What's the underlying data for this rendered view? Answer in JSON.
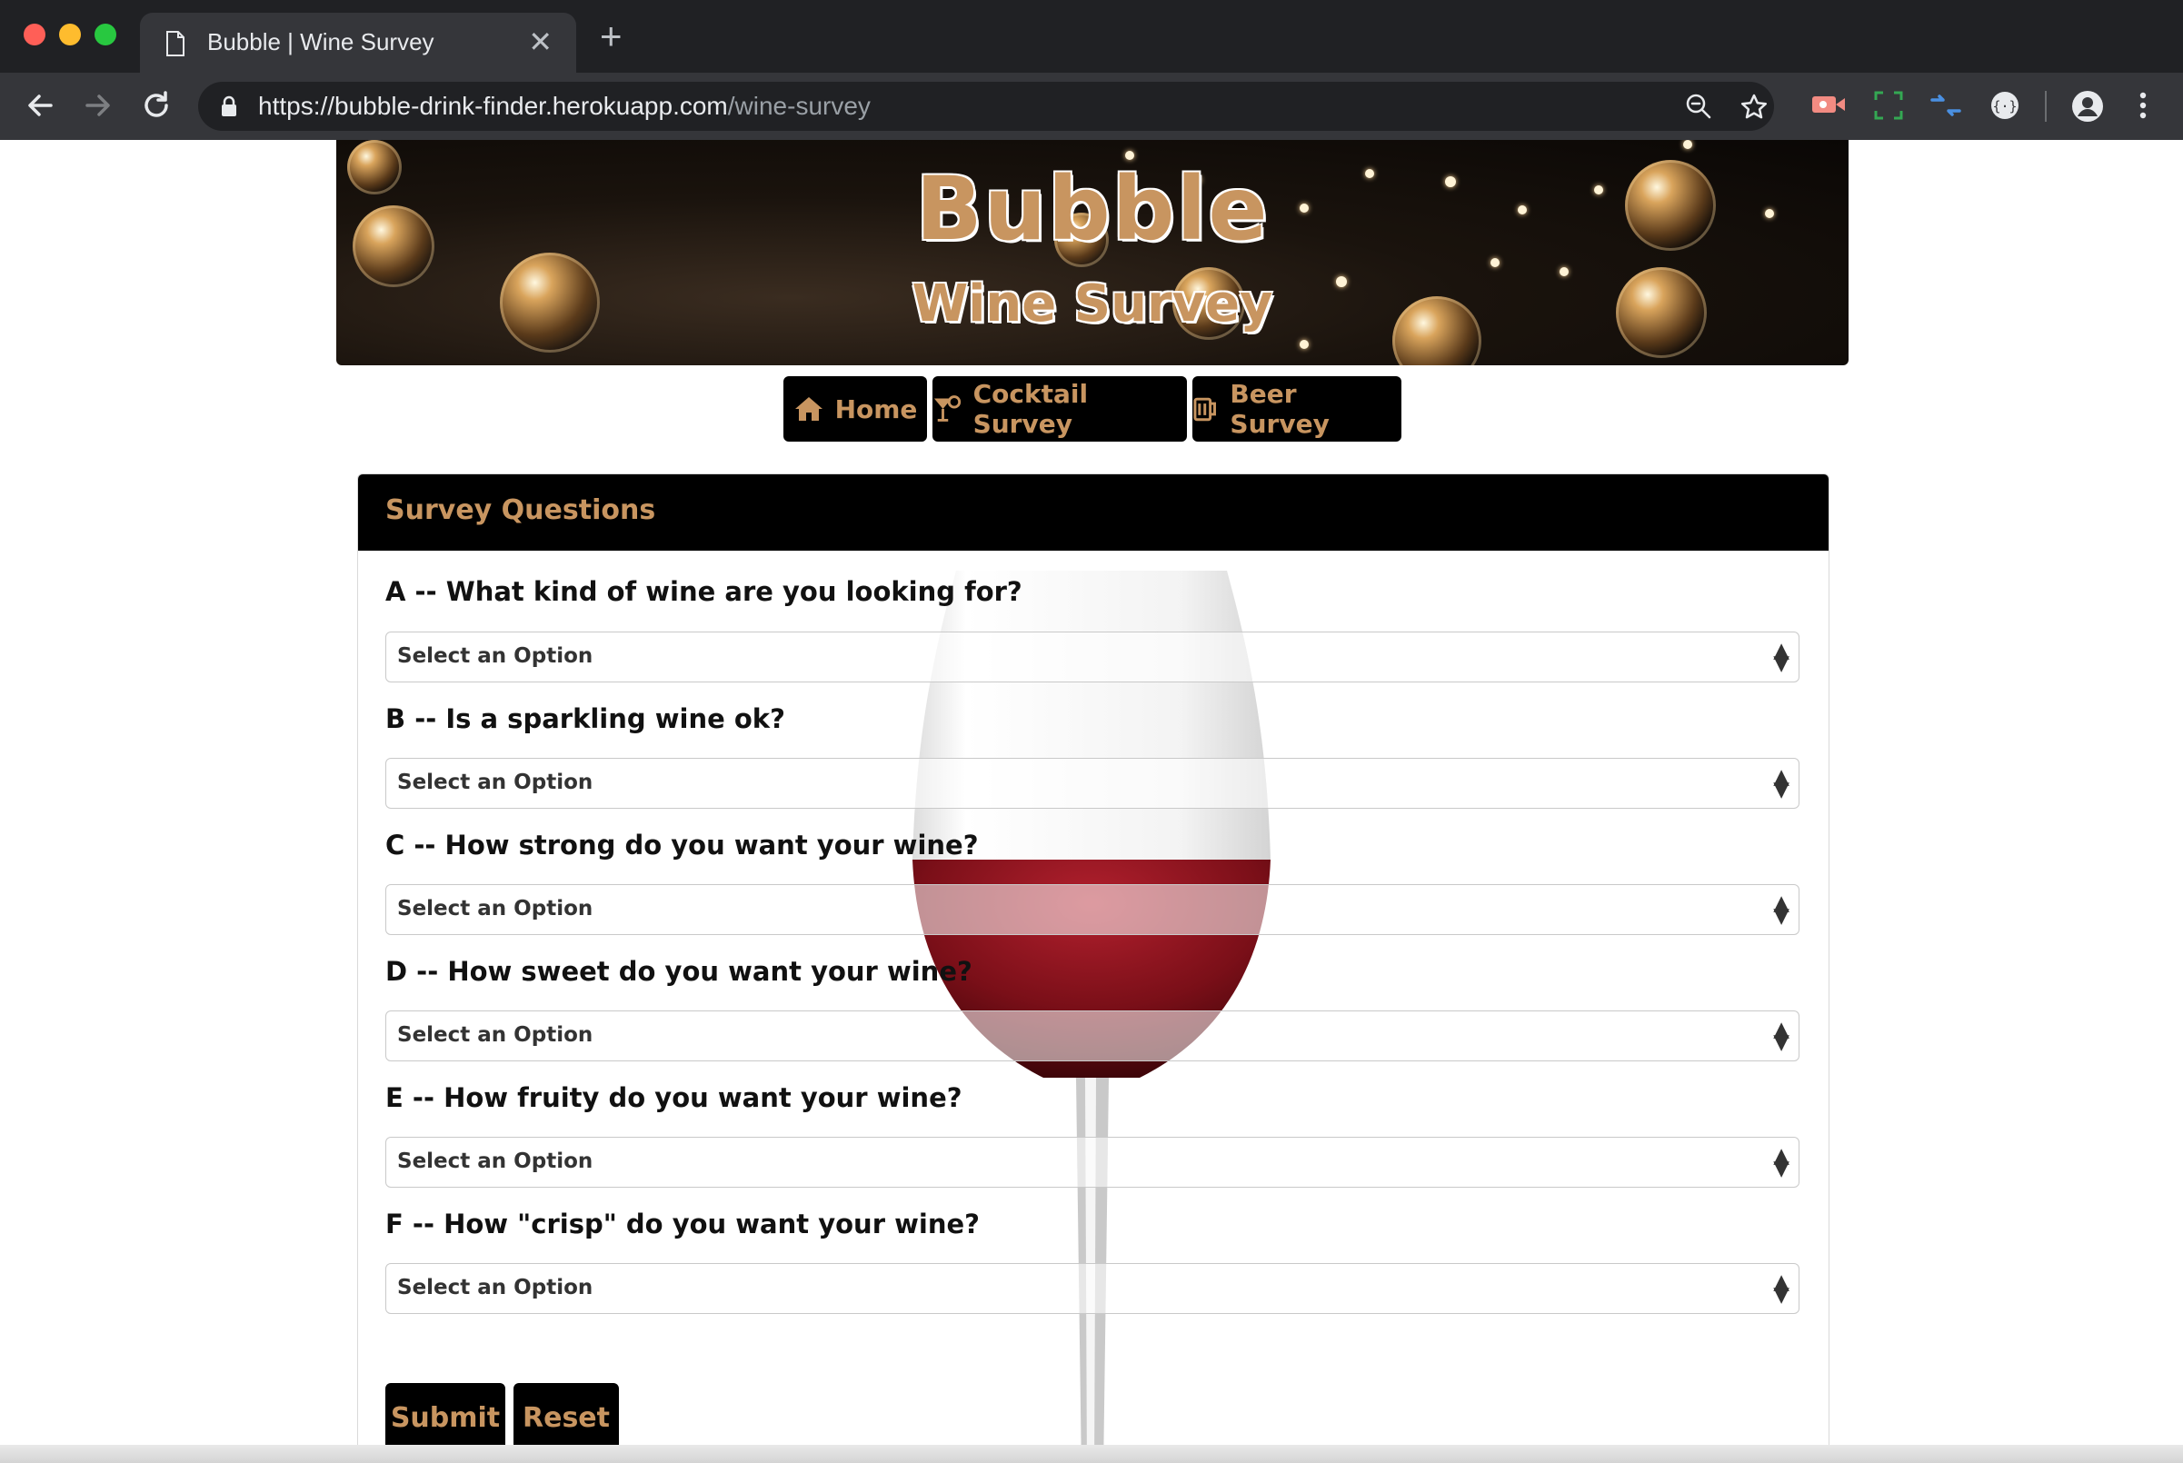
{
  "browser": {
    "tab_title": "Bubble | Wine Survey",
    "tab_close": "✕",
    "new_tab": "+",
    "url_host": "https://bubble-drink-finder.herokuapp.com",
    "url_path": "/wine-survey"
  },
  "banner": {
    "title": "Bubble",
    "subtitle": "Wine Survey"
  },
  "nav": {
    "home": "Home",
    "cocktail": "Cocktail Survey",
    "beer": "Beer Survey"
  },
  "survey": {
    "header": "Survey Questions",
    "questions": [
      {
        "label": "A -- What kind of wine are you looking for?",
        "selected": "Select an Option"
      },
      {
        "label": "B -- Is a sparkling wine ok?",
        "selected": "Select an Option"
      },
      {
        "label": "C -- How strong do you want your wine?",
        "selected": "Select an Option"
      },
      {
        "label": "D -- How sweet do you want your wine?",
        "selected": "Select an Option"
      },
      {
        "label": "E -- How fruity do you want your wine?",
        "selected": "Select an Option"
      },
      {
        "label": "F -- How \"crisp\" do you want your wine?",
        "selected": "Select an Option"
      }
    ],
    "submit": "Submit",
    "reset": "Reset"
  },
  "colors": {
    "accent": "#c89560",
    "header_bg": "#000000",
    "chrome_dark": "#202124",
    "chrome_toolbar": "#35363a"
  }
}
